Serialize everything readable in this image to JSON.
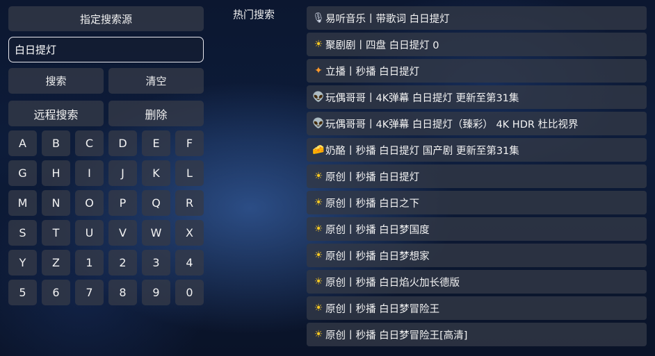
{
  "left_panel": {
    "source_button": "指定搜索源",
    "search_input_value": "白日提灯",
    "search_button": "搜索",
    "clear_button": "清空",
    "remote_search_button": "远程搜索",
    "delete_button": "删除",
    "keys": [
      "A",
      "B",
      "C",
      "D",
      "E",
      "F",
      "G",
      "H",
      "I",
      "J",
      "K",
      "L",
      "M",
      "N",
      "O",
      "P",
      "Q",
      "R",
      "S",
      "T",
      "U",
      "V",
      "W",
      "X",
      "Y",
      "Z",
      "1",
      "2",
      "3",
      "4",
      "5",
      "6",
      "7",
      "8",
      "9",
      "0"
    ]
  },
  "hot": {
    "title": "热门搜索",
    "items": [
      {
        "icon": "🎙",
        "text": "易听音乐丨带歌词 白日提灯"
      },
      {
        "icon": "☀",
        "text": "聚剧剧丨四盘 白日提灯 0"
      },
      {
        "icon": "✦",
        "text": "立播丨秒播 白日提灯"
      },
      {
        "icon": "👽",
        "text": "玩偶哥哥丨4K弹幕 白日提灯 更新至第31集"
      },
      {
        "icon": "👽",
        "text": "玩偶哥哥丨4K弹幕 白日提灯（臻彩） 4K HDR 杜比视界"
      },
      {
        "icon": "🧀",
        "text": "奶酪丨秒播 白日提灯 国产剧 更新至第31集"
      },
      {
        "icon": "☀",
        "text": "原创丨秒播 白日提灯"
      },
      {
        "icon": "☀",
        "text": "原创丨秒播 白日之下"
      },
      {
        "icon": "☀",
        "text": "原创丨秒播 白日梦国度"
      },
      {
        "icon": "☀",
        "text": "原创丨秒播 白日梦想家"
      },
      {
        "icon": "☀",
        "text": "原创丨秒播 白日焰火加长德版"
      },
      {
        "icon": "☀",
        "text": "原创丨秒播 白日梦冒险王"
      },
      {
        "icon": "☀",
        "text": "原创丨秒播 白日梦冒险王[高清]"
      }
    ]
  },
  "icon_names": {
    "microphone": "microphone-icon",
    "sun-cloud": "sun-cloud-icon",
    "sparkle": "sparkle-icon",
    "alien": "alien-icon",
    "cheese": "cheese-icon",
    "sun": "sun-icon"
  }
}
